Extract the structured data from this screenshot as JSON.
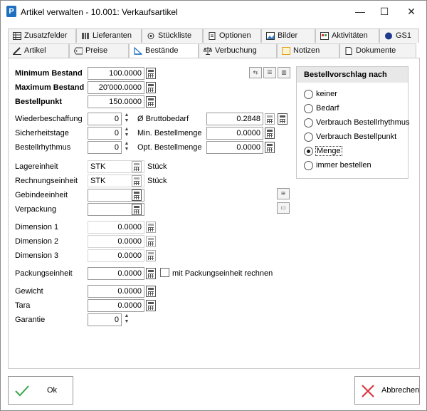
{
  "window": {
    "app_icon": "P",
    "title": "Artikel verwalten - 10.001: Verkaufsartikel",
    "minimize": "—",
    "maximize": "☐",
    "close": "✕"
  },
  "tabs_row1": [
    {
      "label": "Zusatzfelder",
      "icon": "table-icon"
    },
    {
      "label": "Lieferanten",
      "icon": "books-icon"
    },
    {
      "label": "Stückliste",
      "icon": "parts-icon"
    },
    {
      "label": "Optionen",
      "icon": "document-icon"
    },
    {
      "label": "Bilder",
      "icon": "image-icon"
    },
    {
      "label": "Aktivitäten",
      "icon": "activities-icon"
    },
    {
      "label": "GS1",
      "icon": "gs1-icon"
    }
  ],
  "tabs_row2": [
    {
      "label": "Artikel",
      "icon": "pencil-icon"
    },
    {
      "label": "Preise",
      "icon": "price-tag-icon"
    },
    {
      "label": "Bestände",
      "icon": "ruler-icon",
      "active": true
    },
    {
      "label": "Verbuchung",
      "icon": "scale-icon"
    },
    {
      "label": "Notizen",
      "icon": "note-icon"
    },
    {
      "label": "Dokumente",
      "icon": "document-icon"
    }
  ],
  "form": {
    "min_bestand_label": "Minimum Bestand",
    "min_bestand": "100.0000",
    "max_bestand_label": "Maximum Bestand",
    "max_bestand": "20'000.0000",
    "bestellpunkt_label": "Bestellpunkt",
    "bestellpunkt": "150.0000",
    "wiederbeschaffung_label": "Wiederbeschaffung",
    "wiederbeschaffung": "0",
    "sicherheitstage_label": "Sicherheitstage",
    "sicherheitstage": "0",
    "bestellrhythmus_label": "Bestellrhythmus",
    "bestellrhythmus": "0",
    "bruttobedarf_label": "Ø Bruttobedarf",
    "bruttobedarf": "0.2848",
    "min_bestellmenge_label": "Min. Bestellmenge",
    "min_bestellmenge": "0.0000",
    "opt_bestellmenge_label": "Opt. Bestellmenge",
    "opt_bestellmenge": "0.0000",
    "lagereinheit_label": "Lagereinheit",
    "lagereinheit": "STK",
    "lagereinheit_name": "Stück",
    "rechnungseinheit_label": "Rechnungseinheit",
    "rechnungseinheit": "STK",
    "rechnungseinheit_name": "Stück",
    "gebindeeinheit_label": "Gebindeeinheit",
    "gebindeeinheit": "",
    "verpackung_label": "Verpackung",
    "verpackung": "",
    "dimension1_label": "Dimension 1",
    "dimension1": "0.0000",
    "dimension2_label": "Dimension 2",
    "dimension2": "0.0000",
    "dimension3_label": "Dimension 3",
    "dimension3": "0.0000",
    "packungseinheit_label": "Packungseinheit",
    "packungseinheit": "0.0000",
    "packungseinheit_check_label": "mit Packungseinheit rechnen",
    "gewicht_label": "Gewicht",
    "gewicht": "0.0000",
    "tara_label": "Tara",
    "tara": "0.0000",
    "garantie_label": "Garantie",
    "garantie": "0"
  },
  "bestellvorschlag": {
    "title": "Bestellvorschlag nach",
    "options": [
      "keiner",
      "Bedarf",
      "Verbrauch Bestellrhythmus",
      "Verbrauch Bestellpunkt",
      "Menge",
      "immer bestellen"
    ],
    "selected": "Menge"
  },
  "buttons": {
    "ok": "Ok",
    "cancel": "Abbrechen"
  },
  "colors": {
    "ok_check": "#3aa64b",
    "cancel_x": "#d9333a"
  }
}
